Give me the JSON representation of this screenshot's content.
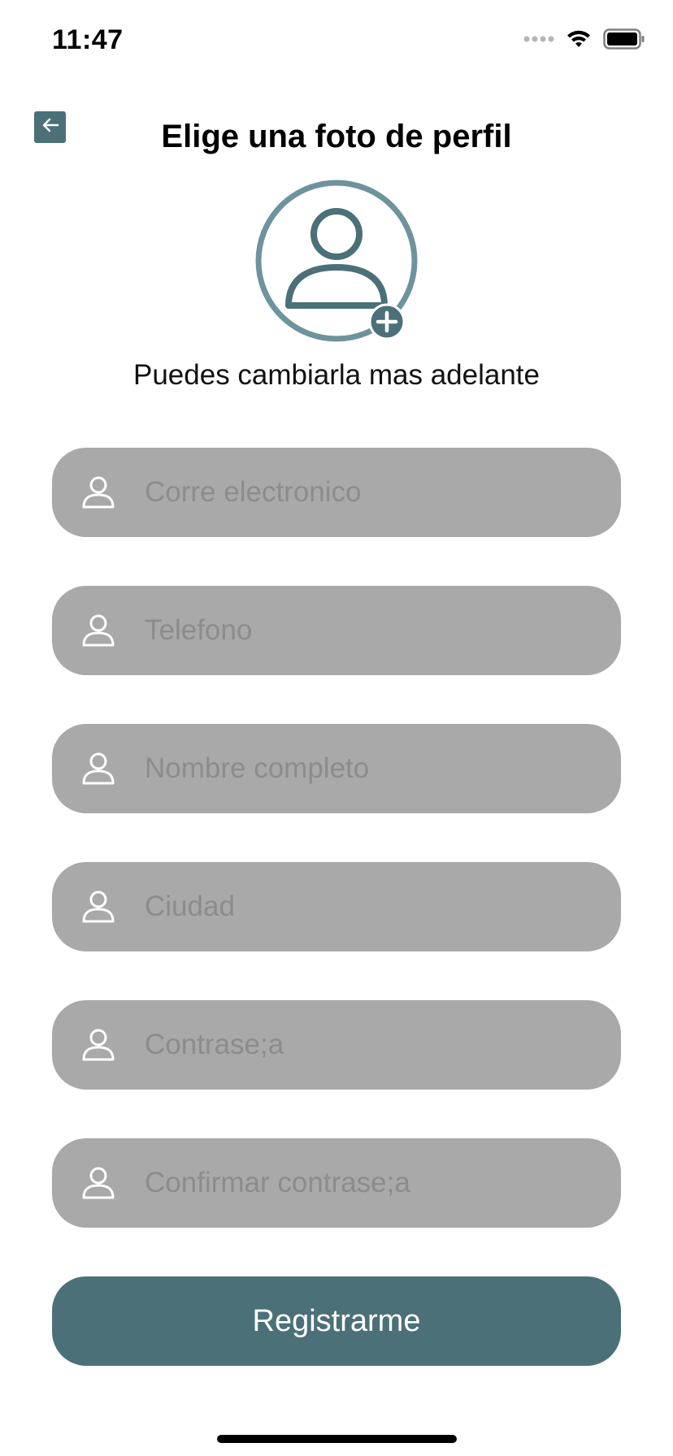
{
  "status_bar": {
    "time": "11:47",
    "icons": [
      "signal-icon",
      "wifi-icon",
      "battery-icon"
    ]
  },
  "header": {
    "back_icon": "arrow-left-icon",
    "title": "Elige una foto de perfil"
  },
  "avatar": {
    "icon": "user-add-icon",
    "subtitle": "Puedes cambiarla mas adelante"
  },
  "form": {
    "fields": [
      {
        "placeholder": "Corre electronico",
        "value": "",
        "icon": "user-icon"
      },
      {
        "placeholder": "Telefono",
        "value": "",
        "icon": "user-icon"
      },
      {
        "placeholder": "Nombre completo",
        "value": "",
        "icon": "user-icon"
      },
      {
        "placeholder": "Ciudad",
        "value": "",
        "icon": "user-icon"
      },
      {
        "placeholder": "Contrase;a",
        "value": "",
        "icon": "user-icon"
      },
      {
        "placeholder": "Confirmar contrase;a",
        "value": "",
        "icon": "user-icon"
      }
    ],
    "submit_label": "Registrarme"
  },
  "colors": {
    "accent": "#4b7078",
    "accent_light": "#6e939c",
    "field_bg": "#a9a9a9",
    "placeholder": "#8c8c8c"
  }
}
